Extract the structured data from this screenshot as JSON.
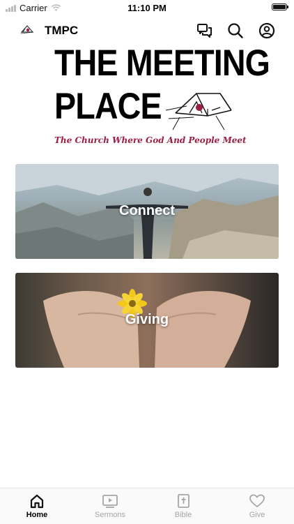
{
  "status_bar": {
    "carrier": "Carrier",
    "time": "11:10 PM"
  },
  "header": {
    "title": "TMPC"
  },
  "banner": {
    "line1": "THE MEETING",
    "line2": "PLACE",
    "tagline": "The Church Where God And People Meet"
  },
  "cards": [
    {
      "label": "Connect"
    },
    {
      "label": "Giving"
    }
  ],
  "tabs": [
    {
      "label": "Home",
      "active": true
    },
    {
      "label": "Sermons",
      "active": false
    },
    {
      "label": "Bible",
      "active": false
    },
    {
      "label": "Give",
      "active": false
    }
  ],
  "colors": {
    "tagline": "#9b1f42",
    "tab_inactive": "#a5a5a5",
    "tab_active": "#000000"
  }
}
